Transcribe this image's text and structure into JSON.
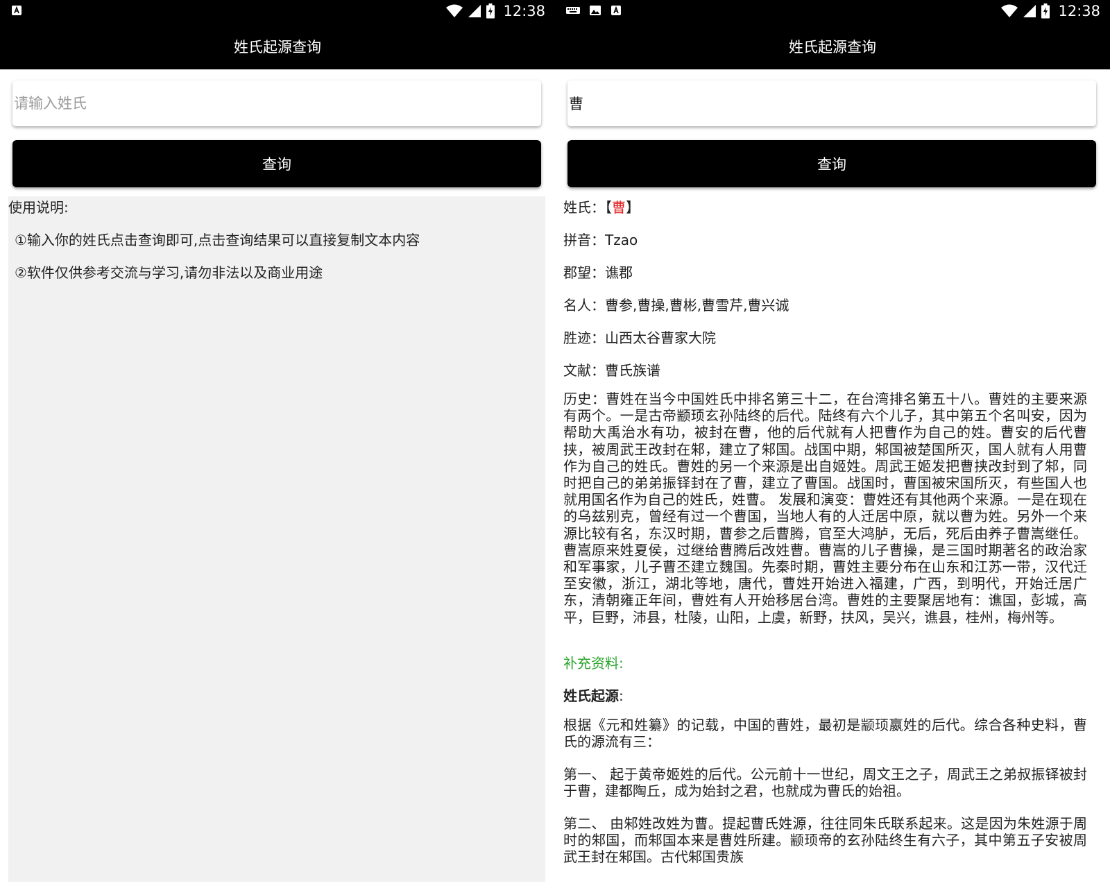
{
  "status": {
    "time_left": "12:38",
    "time_right": "12:38"
  },
  "app": {
    "title": "姓氏起源查询"
  },
  "left": {
    "input_placeholder": "请输入姓氏",
    "button_label": "查询",
    "instructions_title": "使用说明:",
    "instruction_1": "①输入你的姓氏点击查询即可,点击查询结果可以直接复制文本内容",
    "instruction_2": "②软件仅供参考交流与学习,请勿非法以及商业用途"
  },
  "right": {
    "input_value": "曹",
    "button_label": "查询",
    "surname_label": "姓氏：【",
    "surname_value": "曹",
    "surname_close": "】",
    "pinyin": "拼音：Tzao",
    "junwang": "郡望：谯郡",
    "famous": "名人：曹参,曹操,曹彬,曹雪芹,曹兴诚",
    "sites": "胜迹：山西太谷曹家大院",
    "literature": "文献：曹氏族谱",
    "history": "历史：曹姓在当今中国姓氏中排名第三十二，在台湾排名第五十八。曹姓的主要来源有两个。一是古帝颛顼玄孙陆终的后代。陆终有六个儿子，其中第五个名叫安，因为帮助大禹治水有功，被封在曹，他的后代就有人把曹作为自己的姓。曹安的后代曹挟，被周武王改封在邾，建立了邾国。战国中期，邾国被楚国所灭，国人就有人用曹作为自己的姓氏。曹姓的另一个来源是出自姬姓。周武王姬发把曹挟改封到了邾，同时把自己的弟弟振铎封在了曹，建立了曹国。战国时，曹国被宋国所灭，有些国人也就用国名作为自己的姓氏，姓曹。 发展和演变：曹姓还有其他两个来源。一是在现在的乌兹别克，曾经有过一个曹国，当地人有的人迁居中原，就以曹为姓。另外一个来源比较有名，东汉时期，曹参之后曹腾，官至大鸿胪，无后，死后由养子曹嵩继任。曹嵩原来姓夏侯，过继给曹腾后改姓曹。曹嵩的儿子曹操，是三国时期著名的政治家和军事家，儿子曹丕建立魏国。先秦时期，曹姓主要分布在山东和江苏一带，汉代迁至安徽，浙江，湖北等地，唐代，曹姓开始进入福建，广西，到明代，开始迁居广东，清朝雍正年间，曹姓有人开始移居台湾。曹姓的主要聚居地有：谯国，彭城，高平，巨野，沛县，杜陵，山阳，上虞，新野，扶风，吴兴，谯县，桂州，梅州等。",
    "supplement_title": "补充资料:",
    "origin_title": "姓氏起源",
    "origin_colon": ":",
    "origin_intro": "根据《元和姓纂》的记载，中国的曹姓，最初是颛顼嬴姓的后代。综合各种史料，曹氏的源流有三：",
    "origin_1": "第一、 起于黄帝姬姓的后代。公元前十一世纪，周文王之子，周武王之弟叔振铎被封于曹，建都陶丘，成为始封之君，也就成为曹氏的始祖。",
    "origin_2": "第二、 由邾姓改姓为曹。提起曹氏姓源，往往同朱氏联系起来。这是因为朱姓源于周时的邾国，而邾国本来是曹姓所建。颛顼帝的玄孙陆终生有六子，其中第五子安被周武王封在邾国。古代邾国贵族"
  }
}
